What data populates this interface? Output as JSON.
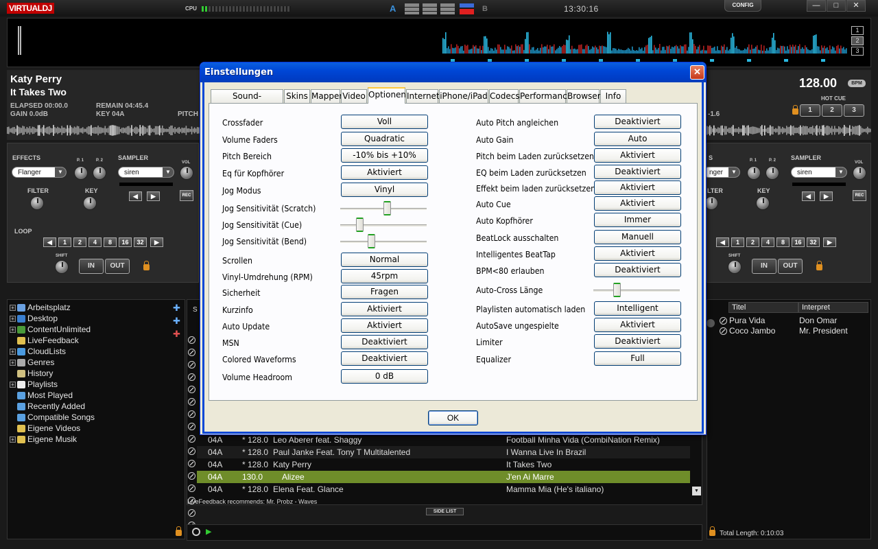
{
  "app": {
    "logo": "VIRTUALDJ",
    "cpu_label": "CPU",
    "clock": "13:30:16",
    "config_label": "CONFIG",
    "deck_a": "A",
    "deck_b": "B",
    "win_buttons": [
      "—",
      "□",
      "✕"
    ]
  },
  "waveform_zoom": [
    "1",
    "2",
    "3"
  ],
  "deck_a": {
    "artist": "Katy Perry",
    "title": "It Takes Two",
    "elapsed": "ELAPSED 00:00.0",
    "remain": "REMAIN 04:45.4",
    "gain": "GAIN 0.0dB",
    "key": "KEY 04A",
    "pitch": "PITCH"
  },
  "deck_b": {
    "bpm": "128.00",
    "bpm_unit": "BPM",
    "pitch": "-1.6",
    "hot_cue_label": "HOT CUE",
    "hot_cues": [
      "1",
      "2",
      "3"
    ]
  },
  "effects": {
    "label": "EFFECTS",
    "p1": "P. 1",
    "p2": "P. 2",
    "effect": "Flanger",
    "effect_b": "nger",
    "filter": "FILTER",
    "filter_b": "LTER",
    "key": "KEY"
  },
  "sampler": {
    "label": "SAMPLER",
    "sample": "siren",
    "vol": "VOL",
    "rec": "REC"
  },
  "loop": {
    "label": "LOOP",
    "sizes": [
      "1",
      "2",
      "4",
      "8",
      "16",
      "32"
    ],
    "shift": "SHIFT",
    "in": "IN",
    "out": "OUT"
  },
  "browser": {
    "items": [
      {
        "label": "Arbeitsplatz",
        "expandable": true,
        "icon_color": "#6aa0e0"
      },
      {
        "label": "Desktop",
        "expandable": true,
        "icon_color": "#3a7fd0"
      },
      {
        "label": "ContentUnlimited",
        "expandable": true,
        "icon_color": "#4a9a3a"
      },
      {
        "label": "LiveFeedback",
        "expandable": false,
        "icon_color": "#e0c050"
      },
      {
        "label": "CloudLists",
        "expandable": true,
        "icon_color": "#4a9ae0"
      },
      {
        "label": "Genres",
        "expandable": true,
        "icon_color": "#aaaaaa"
      },
      {
        "label": "History",
        "expandable": false,
        "icon_color": "#d0c080"
      },
      {
        "label": "Playlists",
        "expandable": true,
        "icon_color": "#eeeeee"
      },
      {
        "label": "Most Played",
        "expandable": false,
        "icon_color": "#5aa0e0"
      },
      {
        "label": "Recently Added",
        "expandable": false,
        "icon_color": "#5aa0e0"
      },
      {
        "label": "Compatible Songs",
        "expandable": false,
        "icon_color": "#5aa0e0"
      },
      {
        "label": "Eigene Videos",
        "expandable": false,
        "icon_color": "#e0c050"
      },
      {
        "label": "Eigene Musik",
        "expandable": true,
        "icon_color": "#e0c050"
      }
    ]
  },
  "tracklist": {
    "rows": [
      {
        "key": "04A",
        "bpm": "* 128.0",
        "artist": "Leo Aberer feat. Shaggy",
        "title": "Football Minha Vida (CombiNation Remix)"
      },
      {
        "key": "04A",
        "bpm": "* 128.0",
        "artist": "Paul Janke Feat. Tony T Multitalented",
        "title": "I Wanna Live In Brazil"
      },
      {
        "key": "04A",
        "bpm": "* 128.0",
        "artist": "Katy Perry",
        "title": "It Takes Two"
      },
      {
        "key": "04A",
        "bpm": "130.0",
        "artist": "Alizee",
        "title": "J'en Ai Marre"
      },
      {
        "key": "04A",
        "bpm": "* 128.0",
        "artist": "Elena Feat. Glance",
        "title": "Mamma Mia (He's italiano)"
      }
    ],
    "header_first_letter": "S",
    "livefeedback": "LiveFeedback recommends: Mr. Probz - Waves",
    "side_list": "SIDE LIST"
  },
  "sidelist": {
    "col_title": "Titel",
    "col_artist": "Interpret",
    "rows": [
      {
        "title": "Pura Vida",
        "artist": "Don Omar"
      },
      {
        "title": "Coco Jambo",
        "artist": "Mr. President"
      }
    ],
    "total_length": "Total Length: 0:10:03"
  },
  "dialog": {
    "title": "Einstellungen",
    "close": "✕",
    "tabs": [
      "Sound-Einstellungen",
      "Skins",
      "Mapper",
      "Video",
      "Optionen",
      "Internet",
      "iPhone/iPad",
      "Codecs",
      "Performance",
      "Browser",
      "Info"
    ],
    "active_tab": "Optionen",
    "left_options": [
      {
        "label": "Crossfader",
        "value": "Voll"
      },
      {
        "label": "Volume Faders",
        "value": "Quadratic"
      },
      {
        "label": "Pitch Bereich",
        "value": "-10% bis +10%"
      },
      {
        "label": "Eq für Kopfhörer",
        "value": "Aktiviert"
      },
      {
        "label": "Jog Modus",
        "value": "Vinyl"
      },
      {
        "label": "Jog Sensitivität (Scratch)",
        "slider": 0.55
      },
      {
        "label": "Jog Sensitivität (Cue)",
        "slider": 0.2
      },
      {
        "label": "Jog Sensitivität (Bend)",
        "slider": 0.35
      },
      {
        "label": "Scrollen",
        "value": "Normal"
      },
      {
        "label": "Vinyl-Umdrehung (RPM)",
        "value": "45rpm"
      },
      {
        "label": "Sicherheit",
        "value": "Fragen"
      },
      {
        "label": "Kurzinfo",
        "value": "Aktiviert"
      },
      {
        "label": "Auto Update",
        "value": "Aktiviert"
      },
      {
        "label": "MSN",
        "value": "Deaktiviert"
      },
      {
        "label": "Colored Waveforms",
        "value": "Deaktiviert"
      },
      {
        "label": "Volume Headroom",
        "value": "0 dB"
      }
    ],
    "right_options": [
      {
        "label": "Auto Pitch angleichen",
        "value": "Deaktiviert"
      },
      {
        "label": "Auto Gain",
        "value": "Auto"
      },
      {
        "label": "Pitch beim Laden zurücksetzen",
        "value": "Aktiviert"
      },
      {
        "label": "EQ beim Laden zurücksetzen",
        "value": "Deaktiviert"
      },
      {
        "label": "Effekt beim laden zurücksetzen",
        "value": "Aktiviert"
      },
      {
        "label": "Auto Cue",
        "value": "Aktiviert"
      },
      {
        "label": "Auto Kopfhörer",
        "value": "Immer"
      },
      {
        "label": "BeatLock ausschalten",
        "value": "Manuell"
      },
      {
        "label": "Intelligentes BeatTap",
        "value": "Aktiviert"
      },
      {
        "label": "BPM<80 erlauben",
        "value": "Deaktiviert"
      },
      {
        "label": "Auto-Cross Länge",
        "slider": 0.25
      },
      {
        "label": "Playlisten automatisch laden",
        "value": "Intelligent"
      },
      {
        "label": "AutoSave ungespielte",
        "value": "Aktiviert"
      },
      {
        "label": "Limiter",
        "value": "Deaktiviert"
      },
      {
        "label": "Equalizer",
        "value": "Full"
      }
    ],
    "ok": "OK"
  },
  "colors": {
    "accent_green": "#6f8d2a",
    "xp_blue": "#0047d6",
    "logo_red": "#c00000",
    "cpu_green": "#33cc33"
  },
  "cpu_level": 0.06
}
